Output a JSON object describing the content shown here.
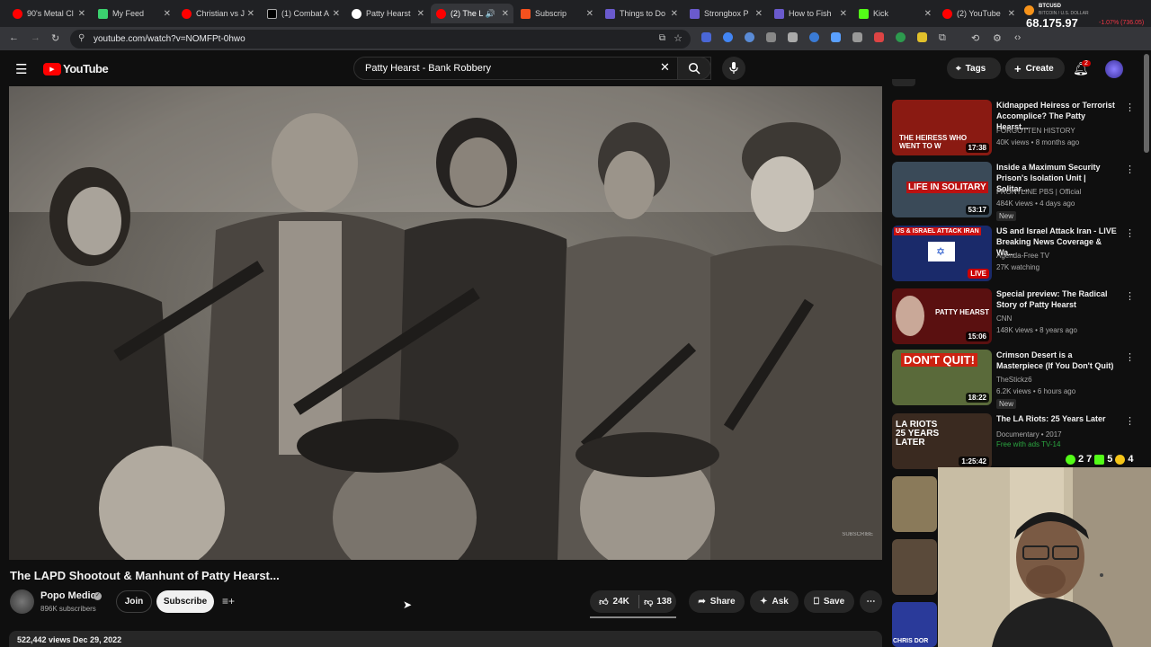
{
  "browser": {
    "tabs": [
      {
        "label": "90's Metal Cl",
        "color": "#ff0000"
      },
      {
        "label": "My Feed",
        "color": "#3bd16f"
      },
      {
        "label": "Christian vs J",
        "color": "#ff0000"
      },
      {
        "label": "(1) Combat A",
        "color": "#888888"
      },
      {
        "label": "Patty Hearst",
        "color": "#4285f4"
      },
      {
        "label": "(2) The L",
        "color": "#ff0000"
      },
      {
        "label": "Subscrip",
        "color": "#f4511e"
      },
      {
        "label": "Things to Do",
        "color": "#6a5acd"
      },
      {
        "label": "Strongbox P",
        "color": "#6a5acd"
      },
      {
        "label": "How to Fish",
        "color": "#6a5acd"
      },
      {
        "label": "Kick",
        "color": "#53fc18"
      },
      {
        "label": "(2) YouTube",
        "color": "#ff0000"
      }
    ],
    "ticker": {
      "symbol": "BTCUSD",
      "sub": "BITCOIN / U.S. DOLLAR",
      "price": "68,175.97",
      "change": "-1.07% (736.05)"
    },
    "url": "youtube.com/watch?v=NOMFPt-0hwo"
  },
  "header": {
    "logo_text": "YouTube",
    "search_value": "Patty Hearst - Bank Robbery",
    "tags_label": "Tags",
    "create_label": "Create",
    "notif_count": "2"
  },
  "video": {
    "watermark": "SUBSCRIBE",
    "title": "The LAPD Shootout & Manhunt of Patty Hearst...",
    "channel": "Popo Medic",
    "subscribers": "896K subscribers",
    "join_label": "Join",
    "subscribe_label": "Subscribe",
    "likes": "24K",
    "dislikes": "138",
    "share_label": "Share",
    "ask_label": "Ask",
    "save_label": "Save",
    "views_date": "522,442 views  Dec 29, 2022"
  },
  "sidebar": {
    "items": [
      {
        "title": "Kidnapped Heiress or Terrorist Accomplice? The Patty Hearst...",
        "channel": "FORGOTTEN HISTORY",
        "meta": "40K views • 8 months ago",
        "duration": "17:38",
        "thumb_text": "THE HEIRESS WHO WENT TO W",
        "thumb_color": "#8a1a12"
      },
      {
        "title": "Inside a Maximum Security Prison's Isolation Unit | Solitar...",
        "channel": "FRONTLINE PBS | Official",
        "meta": "484K views • 4 days ago",
        "duration": "53:17",
        "thumb_text": "LIFE IN SOLITARY",
        "thumb_color": "#3a4a58",
        "badge": "New"
      },
      {
        "title": "US and Israel Attack Iran - LIVE Breaking News Coverage & Wa...",
        "channel": "Agenda-Free TV",
        "meta": "27K watching",
        "duration": "LIVE",
        "thumb_text": "US & ISRAEL ATTACK IRAN",
        "thumb_color": "#1a2a6a"
      },
      {
        "title": "Special preview: The Radical Story of Patty Hearst",
        "channel": "CNN",
        "meta": "148K views • 8 years ago",
        "duration": "15:06",
        "thumb_text": "PATTY HEARST",
        "thumb_color": "#5a1010"
      },
      {
        "title": "Crimson Desert is a Masterpiece (If You Don't Quit)",
        "channel": "TheStickz6",
        "meta": "6.2K views • 6 hours ago",
        "duration": "18:22",
        "thumb_text": "DON'T QUIT!",
        "thumb_color": "#5a6a3a",
        "badge": "New"
      },
      {
        "title": "The LA Riots: 25 Years Later",
        "channel": "Documentary • 2017",
        "meta": "Free with ads  TV-14",
        "duration": "1:25:42",
        "thumb_text": "LA RIOTS 25 YEARS LATER",
        "thumb_color": "#3a2a20"
      }
    ],
    "overlay_counts": {
      "a": "2 7",
      "b": "5",
      "c": "4"
    },
    "partial_thumb_text": "CHRIS DOR"
  }
}
